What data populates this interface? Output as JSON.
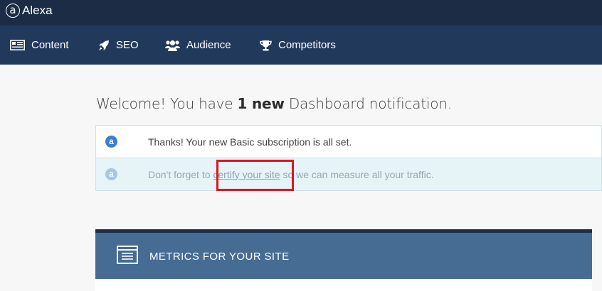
{
  "brand": {
    "name": "Alexa",
    "mark": "a"
  },
  "nav": [
    {
      "label": "Content",
      "icon": "newspaper-icon"
    },
    {
      "label": "SEO",
      "icon": "rocket-icon"
    },
    {
      "label": "Audience",
      "icon": "users-icon"
    },
    {
      "label": "Competitors",
      "icon": "trophy-icon"
    }
  ],
  "welcome": {
    "prefix": "Welcome! You have ",
    "count": "1 new",
    "suffix": " Dashboard notification."
  },
  "notifications": [
    {
      "badge": "a",
      "text": "Thanks! Your new Basic subscription is all set."
    },
    {
      "badge": "a",
      "text_before": "Don't forget to ",
      "link": "certify your site",
      "text_after": " so we can measure all your traffic."
    }
  ],
  "metrics_panel": {
    "title": "METRICS FOR YOUR SITE",
    "icon": "browser-window-icon"
  },
  "colors": {
    "topbar": "#1b2c44",
    "navbar": "#213a5b",
    "panel_header": "#466c94",
    "highlight": "#e0131e"
  }
}
